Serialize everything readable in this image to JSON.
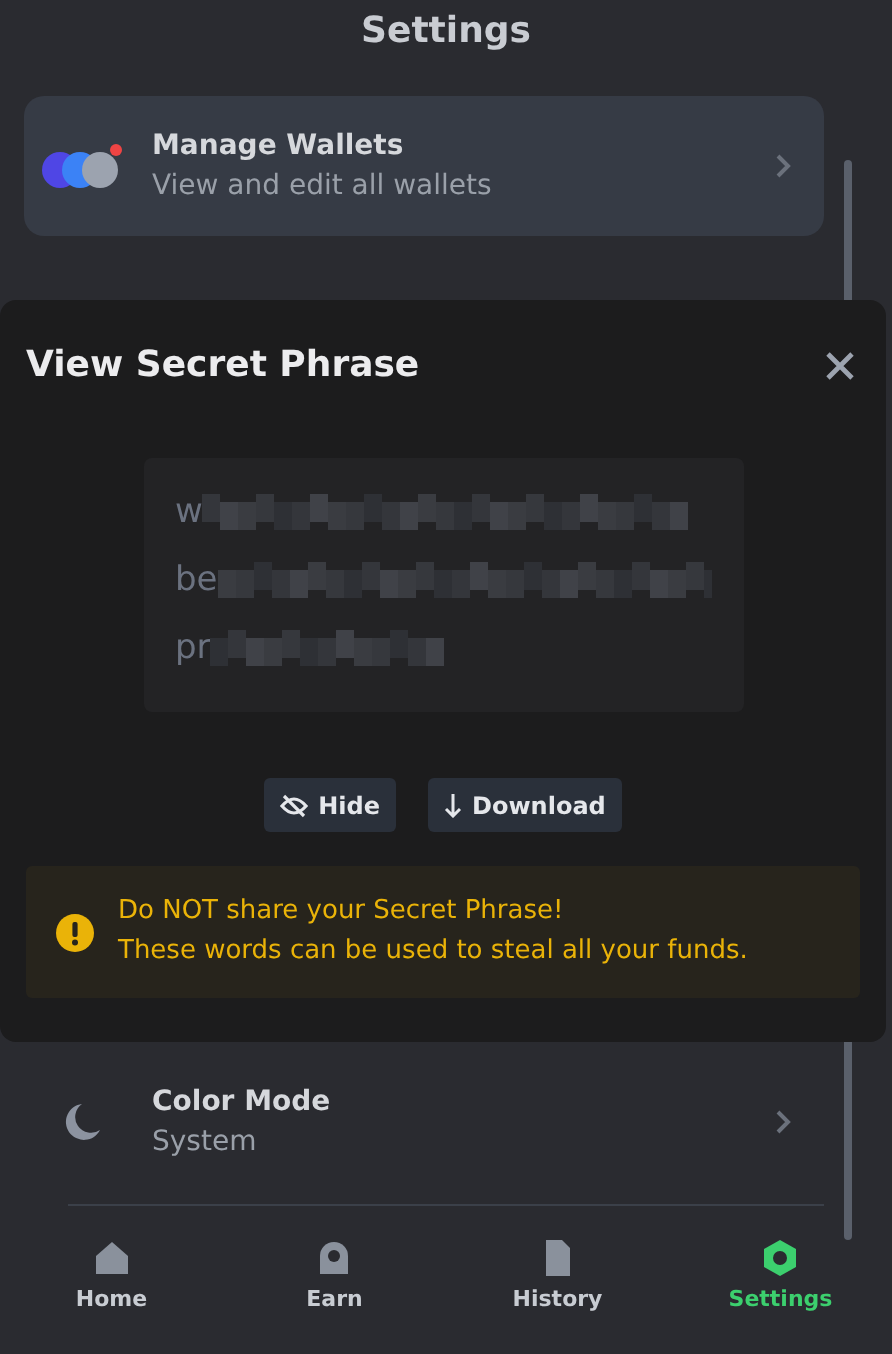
{
  "page": {
    "title": "Settings"
  },
  "settings_items": [
    {
      "kind": "wallets",
      "title": "Manage Wallets",
      "subtitle": "View and edit all wallets",
      "highlighted": true
    },
    {
      "kind": "color-mode",
      "title": "Color Mode",
      "subtitle": "System",
      "highlighted": false
    }
  ],
  "bottom_nav": [
    {
      "label": "Home",
      "selected": false
    },
    {
      "label": "Earn",
      "selected": false
    },
    {
      "label": "History",
      "selected": false
    },
    {
      "label": "Settings",
      "selected": true
    }
  ],
  "modal": {
    "title": "View Secret Phrase",
    "phrase_lines": [
      "w",
      "be",
      "pr"
    ],
    "buttons": [
      {
        "kind": "hide",
        "label": "Hide"
      },
      {
        "kind": "download",
        "label": "Download"
      }
    ],
    "warning": {
      "line_1": "Do NOT share your Secret Phrase!",
      "line_2": "These words can be used to steal all your funds."
    }
  }
}
